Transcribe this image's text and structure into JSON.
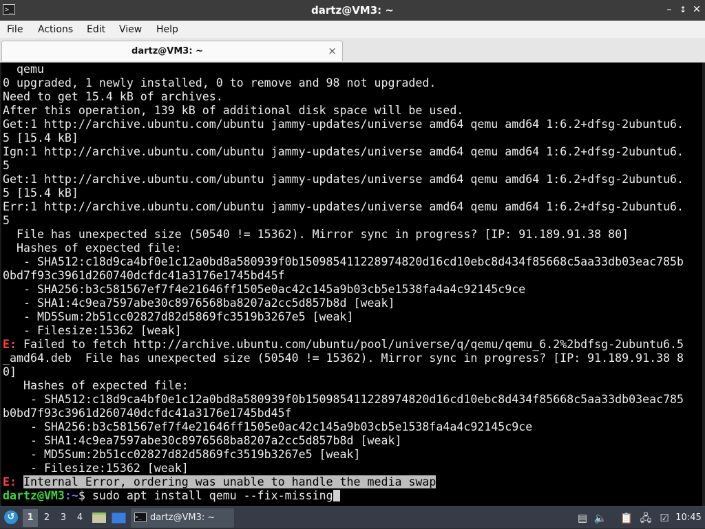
{
  "window": {
    "title": "dartz@VM3: ~",
    "controls": {
      "minimize": "minimize-icon",
      "maximize": "maximize-icon",
      "close": "close-icon"
    }
  },
  "menu": {
    "items": [
      "File",
      "Actions",
      "Edit",
      "View",
      "Help"
    ]
  },
  "tab": {
    "label": "dartz@VM3: ~",
    "close": "×"
  },
  "terminal": {
    "lines": [
      "  qemu",
      "0 upgraded, 1 newly installed, 0 to remove and 98 not upgraded.",
      "Need to get 15.4 kB of archives.",
      "After this operation, 139 kB of additional disk space will be used.",
      "Get:1 http://archive.ubuntu.com/ubuntu jammy-updates/universe amd64 qemu amd64 1:6.2+dfsg-2ubuntu6.",
      "5 [15.4 kB]",
      "Ign:1 http://archive.ubuntu.com/ubuntu jammy-updates/universe amd64 qemu amd64 1:6.2+dfsg-2ubuntu6.",
      "5",
      "Get:1 http://archive.ubuntu.com/ubuntu jammy-updates/universe amd64 qemu amd64 1:6.2+dfsg-2ubuntu6.",
      "5 [15.4 kB]",
      "Err:1 http://archive.ubuntu.com/ubuntu jammy-updates/universe amd64 qemu amd64 1:6.2+dfsg-2ubuntu6.",
      "5",
      "  File has unexpected size (50540 != 15362). Mirror sync in progress? [IP: 91.189.91.38 80]",
      "  Hashes of expected file:",
      "   - SHA512:c18d9ca4bf0e1c12a0bd8a580939f0b150985411228974820d16cd10ebc8d434f85668c5aa33db03eac785b",
      "0bd7f93c3961d260740dcfdc41a3176e1745bd45f",
      "   - SHA256:b3c581567ef7f4e21646ff1505e0ac42c145a9b03cb5e1538fa4a4c92145c9ce",
      "   - SHA1:4c9ea7597abe30c8976568ba8207a2cc5d857b8d [weak]",
      "   - MD5Sum:2b51cc02827d82d5869fc3519b3267e5 [weak]",
      "   - Filesize:15362 [weak]"
    ],
    "error_fetch": {
      "prefix": "E:",
      "lines": [
        " Failed to fetch http://archive.ubuntu.com/ubuntu/pool/universe/q/qemu/qemu_6.2%2bdfsg-2ubuntu6.5",
        "_amd64.deb  File has unexpected size (50540 != 15362). Mirror sync in progress? [IP: 91.189.91.38 8",
        "0]",
        "   Hashes of expected file:",
        "    - SHA512:c18d9ca4bf0e1c12a0bd8a580939f0b150985411228974820d16cd10ebc8d434f85668c5aa33db03eac785",
        "b0bd7f93c3961d260740dcfdc41a3176e1745bd45f",
        "    - SHA256:b3c581567ef7f4e21646ff1505e0ac42c145a9b03cb5e1538fa4a4c92145c9ce",
        "    - SHA1:4c9ea7597abe30c8976568ba8207a2cc5d857b8d [weak]",
        "    - MD5Sum:2b51cc02827d82d5869fc3519b3267e5 [weak]",
        "    - Filesize:15362 [weak]"
      ]
    },
    "error_internal": {
      "prefix": "E:",
      "message": "Internal Error, ordering was unable to handle the media swap"
    },
    "prompt": {
      "user_host": "dartz@VM3",
      "path": ":~",
      "symbol": "$",
      "command": " sudo apt install qemu --fix-missing"
    }
  },
  "taskbar": {
    "start_icon": "start-menu-icon",
    "workspaces": [
      "1",
      "2",
      "3",
      "4"
    ],
    "active_workspace": "1",
    "launchers": [
      "file-manager-icon",
      "show-desktop-icon"
    ],
    "task": {
      "icon": "terminal-icon",
      "label": "dartz@VM3: ~"
    },
    "tray": [
      "window-list-icon",
      "volume-icon",
      "clipboard-icon",
      "network-icon",
      "checkbox-icon"
    ],
    "clock": "10:45"
  },
  "colors": {
    "terminal_bg": "#000000",
    "terminal_fg": "#ececec",
    "error": "#ff4040",
    "prompt_user": "#3fd33f",
    "prompt_path": "#5c7cfa",
    "highlight_bg": "#bdbdbd",
    "titlebar_bg": "#3c3c3c",
    "taskbar_bg": "#353c47"
  }
}
